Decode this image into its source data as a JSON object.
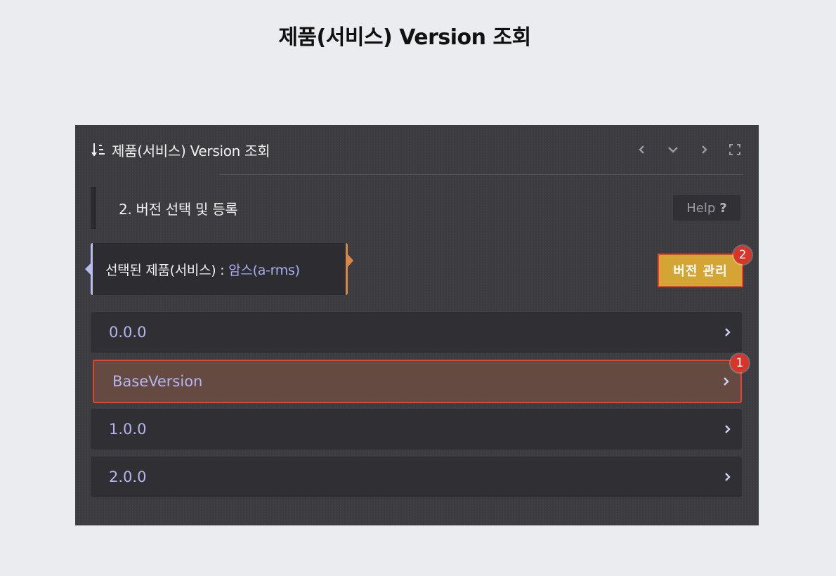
{
  "page": {
    "title": "제품(서비스) Version 조회"
  },
  "panel": {
    "title": "제품(서비스) Version 조회",
    "sort_icon": "sort-descending-icon",
    "controls": [
      {
        "name": "chevron-left-icon"
      },
      {
        "name": "chevron-down-icon"
      },
      {
        "name": "chevron-right-icon"
      },
      {
        "name": "fullscreen-icon"
      }
    ]
  },
  "section": {
    "title": "2. 버전 선택 및 등록",
    "help_label": "Help",
    "help_icon": "?"
  },
  "selection": {
    "label": "선택된 제품(서비스) :",
    "value": "암스(a-rms)"
  },
  "actions": {
    "manage_label": "버전 관리"
  },
  "versions": [
    {
      "label": "0.0.0",
      "highlighted": false
    },
    {
      "label": "BaseVersion",
      "highlighted": true
    },
    {
      "label": "1.0.0",
      "highlighted": false
    },
    {
      "label": "2.0.0",
      "highlighted": false
    }
  ],
  "badges": {
    "version_row": "1",
    "manage_button": "2"
  },
  "colors": {
    "panel_bg": "#3b3b40",
    "row_bg": "#303034",
    "highlight_bg": "#654a42",
    "highlight_border": "#e8412c",
    "version_text": "#b3b5ef",
    "button_bg": "#d4a534",
    "badge_bg": "#d9342a"
  }
}
